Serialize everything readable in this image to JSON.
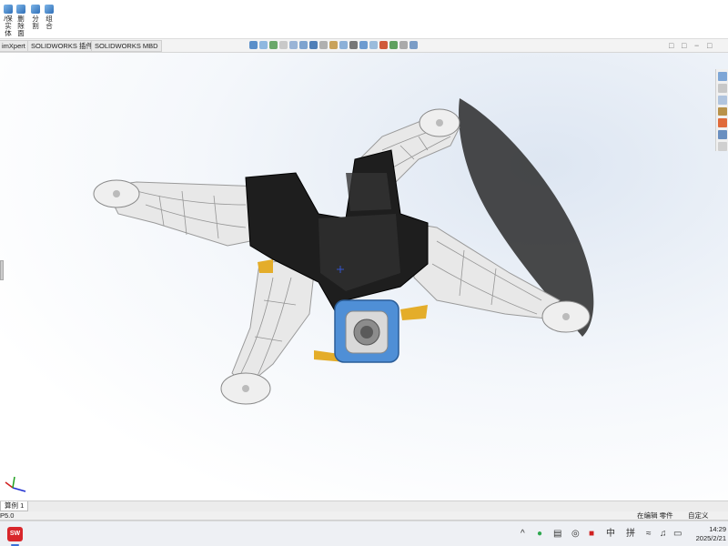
{
  "ribbon": {
    "buttons": [
      {
        "label": "/保实体",
        "icon": "save-bodies-icon"
      },
      {
        "label": "删除面",
        "icon": "delete-face-icon"
      },
      {
        "label": "分割",
        "icon": "split-icon"
      },
      {
        "label": "组合",
        "icon": "combine-icon"
      }
    ]
  },
  "command_tabs": [
    "imXpert",
    "SOLIDWORKS 插件",
    "SOLIDWORKS MBD"
  ],
  "sheet_tab": "算例 1",
  "status": {
    "left": "P5.0",
    "mode": "在编辑 零件",
    "units": "自定义"
  },
  "taskbar": {
    "app": "SW",
    "tray": [
      "^",
      "中",
      "拼"
    ],
    "time": "14:29",
    "date": "2025/2/21"
  },
  "colors": {
    "frame_black": "#1e1e1e",
    "lattice_white": "#eaeaea",
    "camera_blue": "#4f8fd6",
    "battery_gold": "#e4ad2a",
    "viewport_bg": "#eef3f9"
  }
}
